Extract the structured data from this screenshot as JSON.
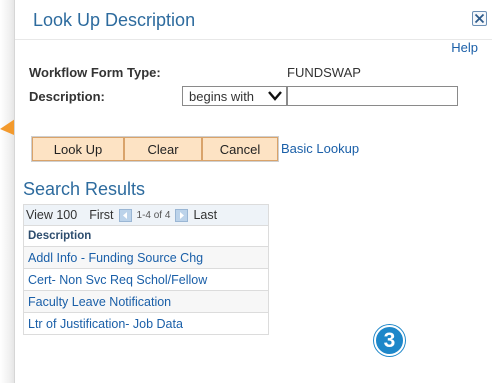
{
  "dialog": {
    "title": "Look Up Description",
    "help_label": "Help"
  },
  "form": {
    "workflow_type_label": "Workflow Form Type:",
    "workflow_type_value": "FUNDSWAP",
    "description_label": "Description:",
    "operator_selected": "begins with",
    "description_value": ""
  },
  "buttons": {
    "lookup": "Look Up",
    "clear": "Clear",
    "cancel": "Cancel",
    "basic_lookup": "Basic Lookup"
  },
  "results": {
    "title": "Search Results",
    "view_all": "View 100",
    "first": "First",
    "range": "1-4 of 4",
    "last": "Last",
    "column_header": "Description",
    "rows": [
      "Addl Info - Funding Source Chg",
      "Cert- Non Svc Req Schol/Fellow",
      "Faculty Leave Notification",
      "Ltr of Justification- Job Data"
    ]
  },
  "step_badge": "3",
  "colors": {
    "accent_blue": "#2d6b9e",
    "link_blue": "#1a5fa8",
    "button_fill": "#fde3c4",
    "arrow_orange": "#f39a2d",
    "badge_blue": "#1e87c9"
  }
}
